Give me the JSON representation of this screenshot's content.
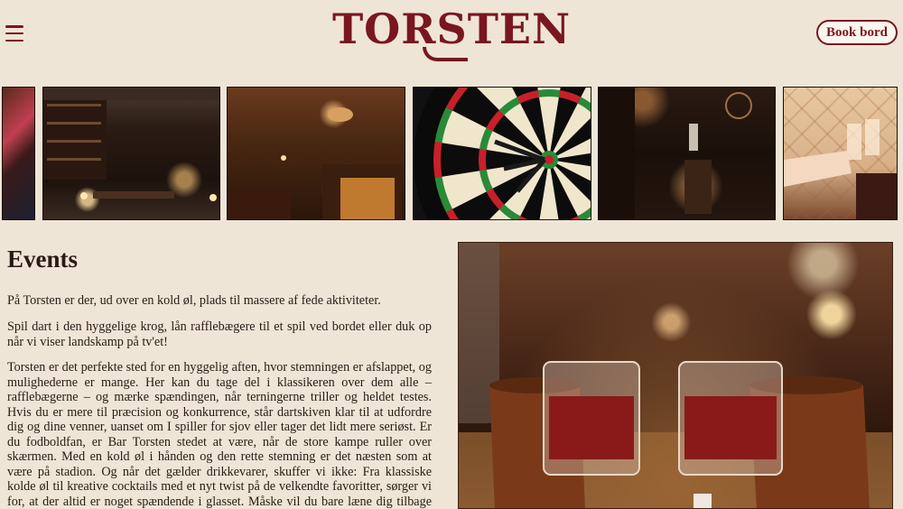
{
  "header": {
    "logo_text": "TORSTEN",
    "book_label": "Book bord",
    "accent": "#7a1620",
    "menu_icon": "hamburger-icon"
  },
  "gallery": {
    "photos": [
      {
        "subject": "cocktail-glass-crop"
      },
      {
        "subject": "library-lounge"
      },
      {
        "subject": "fireplace-lounge"
      },
      {
        "subject": "dartboard"
      },
      {
        "subject": "bar-taps"
      },
      {
        "subject": "toasting-glasses"
      }
    ]
  },
  "events": {
    "title": "Events",
    "p1": "På Torsten er der, ud over en kold øl, plads til massere af fede aktiviteter.",
    "p2": "Spil dart i den hyggelige krog, lån rafflebægere til et spil ved bordet eller duk op når vi viser landskamp på tv'et!",
    "p3": "Torsten er det perfekte sted for en hyggelig aften, hvor stemningen er afslappet, og mulighederne er mange. Her kan du tage del i klassikeren over dem alle – rafflebægerne – og mærke spændingen, når terningerne triller og heldet testes. Hvis du er mere til præcision og konkurrence, står dartskiven klar til at udfordre dig og dine venner, uanset om I spiller for sjov eller tager det lidt mere seriøst. Er du fodboldfan, er Bar Torsten stedet at være, når de store kampe ruller over skærmen. Med en kold øl i hånden og den rette stemning er det næsten som at være på stadion. Og når det gælder drikkevarer, skuffer vi ikke: Fra klassiske kolde øl til kreative cocktails med et nyt twist på de velkendte favoritter, sørger vi for, at der altid er noget spændende i glasset. Måske vil du bare læne dig tilbage og nyde atmosfæren. Bar Torsten handler om at skabe gode stunder, uanset om du vil spille, se sport eller bare nyde selskabet med vennerne over en"
  }
}
